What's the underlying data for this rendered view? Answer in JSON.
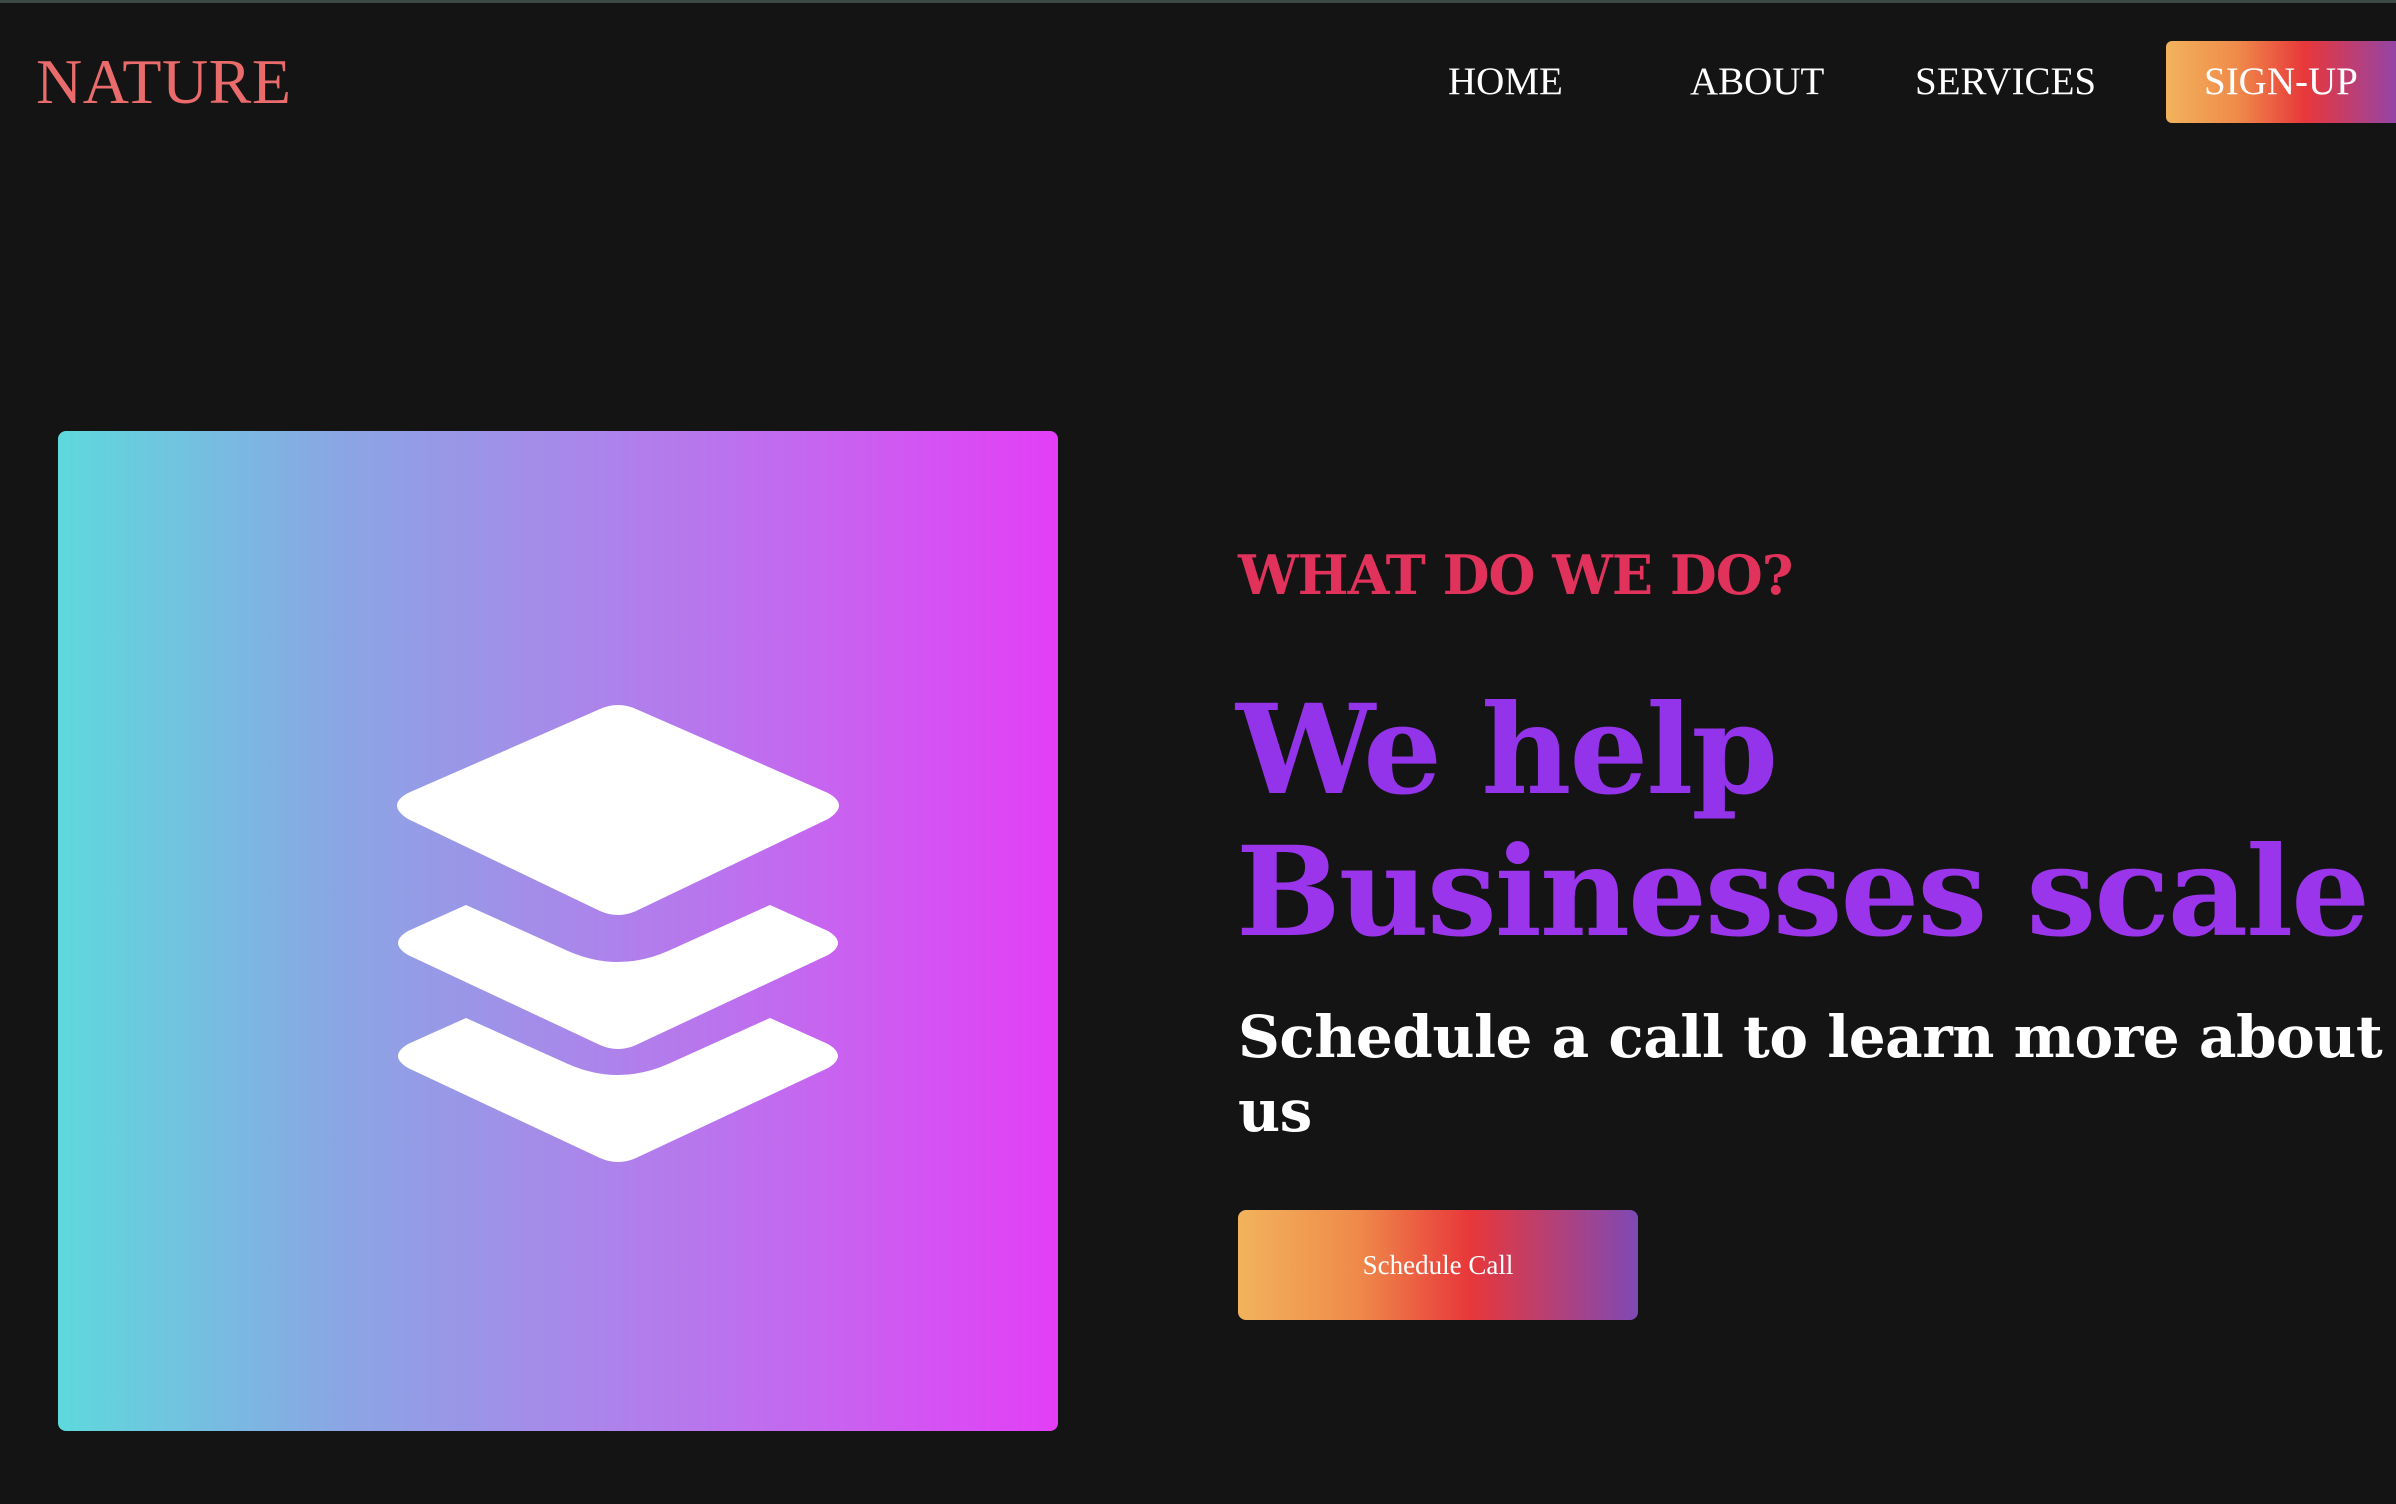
{
  "nav": {
    "brand": "NATURE",
    "links": [
      "HOME",
      "ABOUT",
      "SERVICES"
    ],
    "signup_label": "SIGN-UP"
  },
  "hero": {
    "image_icon": "layers-icon",
    "eyebrow": "WHAT DO WE DO?",
    "headline_line1": "We help",
    "headline_line2": "Businesses scale",
    "subhead": "Schedule a call to learn more about us",
    "cta_label": "Schedule Call"
  },
  "colors": {
    "background": "#141414",
    "brand": "#ea6b6b",
    "eyebrow": "#e0325a",
    "headline": "#9333ea",
    "gradient_start": "#5ed9dc",
    "gradient_end": "#e33ef6"
  }
}
